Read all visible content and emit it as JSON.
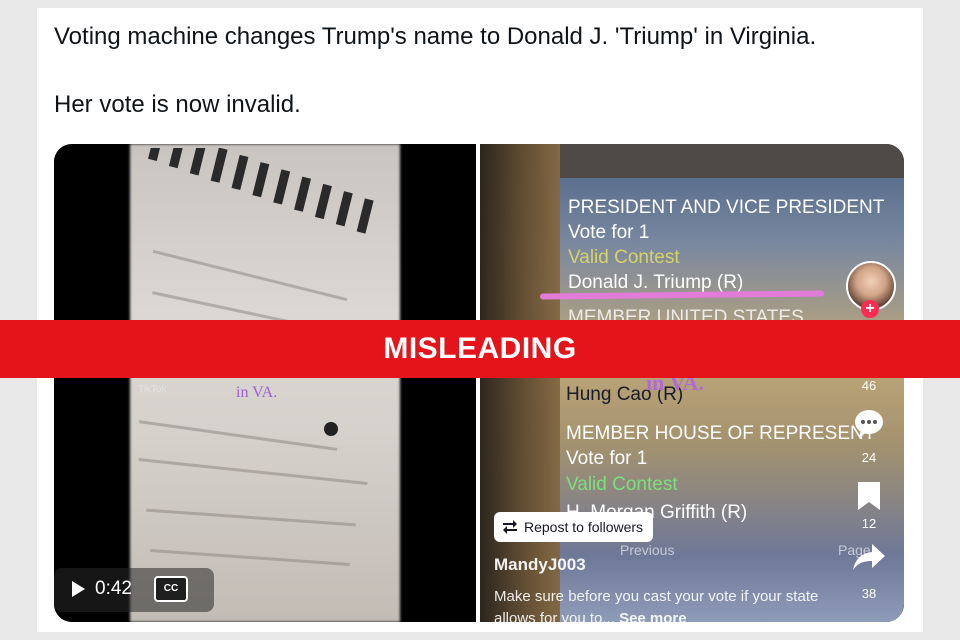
{
  "post": {
    "line1": "Voting machine changes Trump's name to Donald J. 'Triump' in Virginia.",
    "line2": "Her vote is now invalid."
  },
  "video": {
    "time": "0:42",
    "cc_label": "CC",
    "left_overlay_text": "in VA.",
    "left_watermark": "TikTok"
  },
  "ballot": {
    "heading1": "PRESIDENT AND VICE PRESIDENT",
    "vote_for_1": "Vote for 1",
    "valid_contest_1": "Valid Contest",
    "candidate1": "Donald J. Triump (R)",
    "heading2": "MEMBER UNITED STATES",
    "candidate2": "Hung Cao (R)",
    "heading3": "MEMBER HOUSE OF REPRESENT",
    "vote_for_2": "Vote for 1",
    "valid_contest_2": "Valid Contest",
    "candidate3": "H. Morgan Griffith (R)",
    "previous_label": "Previous",
    "page_label": "Page"
  },
  "tiktok": {
    "overlay_text": "in VA.",
    "like_count": "46",
    "comment_count": "24",
    "save_count": "12",
    "share_count": "38",
    "repost_label": "Repost to followers",
    "username": "MandyJ003",
    "caption": "Make sure before you cast your vote if your state allows for you to...",
    "see_more": "See more"
  },
  "banner": {
    "label": "MISLEADING"
  },
  "colors": {
    "banner_red": "#e5141b",
    "tiktok_red": "#fe2c55",
    "pink_underline": "#e37bd8"
  }
}
